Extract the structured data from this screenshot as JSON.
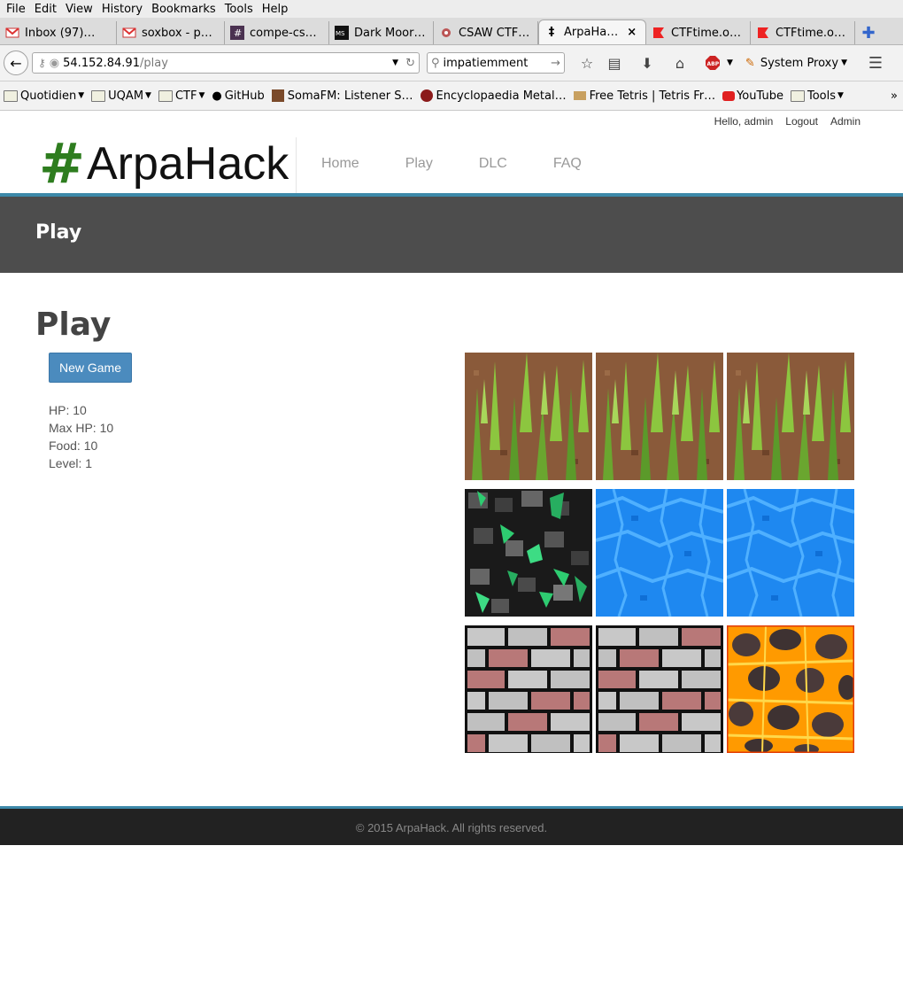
{
  "browser": {
    "menu": [
      "File",
      "Edit",
      "View",
      "History",
      "Bookmarks",
      "Tools",
      "Help"
    ],
    "tabs": [
      {
        "label": "Inbox (97)…",
        "icon": "gmail-icon"
      },
      {
        "label": "soxbox - p…",
        "icon": "gmail-icon"
      },
      {
        "label": "compe-cs…",
        "icon": "hash-icon"
      },
      {
        "label": "Dark Moor…",
        "icon": "site-icon"
      },
      {
        "label": "CSAW CTF…",
        "icon": "site-icon"
      },
      {
        "label": "ArpaHa…",
        "icon": "arpahack-icon",
        "active": true
      },
      {
        "label": "CTFtime.o…",
        "icon": "ctftime-icon"
      },
      {
        "label": "CTFtime.o…",
        "icon": "ctftime-icon"
      }
    ],
    "url_host": "54.152.84.91",
    "url_path": "/play",
    "search_value": "impatiemment",
    "proxy_label": "System Proxy",
    "bookmarks": [
      {
        "label": "Quotidien",
        "type": "folder"
      },
      {
        "label": "UQAM",
        "type": "folder"
      },
      {
        "label": "CTF",
        "type": "folder"
      },
      {
        "label": "GitHub",
        "type": "link"
      },
      {
        "label": "SomaFM: Listener S…",
        "type": "link"
      },
      {
        "label": "Encyclopaedia Metal…",
        "type": "link"
      },
      {
        "label": "Free Tetris | Tetris Fr…",
        "type": "link"
      },
      {
        "label": "YouTube",
        "type": "link"
      },
      {
        "label": "Tools",
        "type": "folder"
      }
    ],
    "overflow": "»"
  },
  "site": {
    "user_links": {
      "greeting": "Hello, admin",
      "logout": "Logout",
      "admin": "Admin"
    },
    "logo_hash": "#",
    "logo_text": "ArpaHack",
    "nav": [
      "Home",
      "Play",
      "DLC",
      "FAQ"
    ],
    "banner_title": "Play",
    "page_title": "Play",
    "new_game_label": "New Game",
    "stats": [
      "HP: 10",
      "Max HP: 10",
      "Food: 10",
      "Level: 1"
    ],
    "tiles": [
      [
        "grass",
        "grass",
        "grass"
      ],
      [
        "emerald-ore",
        "water",
        "water"
      ],
      [
        "brick",
        "brick",
        "lava"
      ]
    ],
    "footer": "© 2015 ArpaHack. All rights reserved."
  }
}
